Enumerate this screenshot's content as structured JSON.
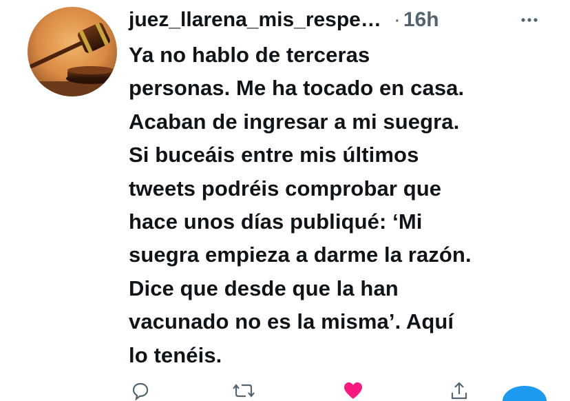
{
  "tweet": {
    "username": "juez_llarena_mis_respe…",
    "separator": "·",
    "time": "16h",
    "body_lines": [
      "Ya no hablo de terceras",
      "personas. Me ha tocado en casa.",
      "Acaban de ingresar a mi suegra.",
      "Si buceáis entre mis últimos",
      "tweets podréis comprobar que",
      "hace unos días publiqué: ‘Mi",
      "suegra empieza a darme la razón.",
      "Dice que desde que la han",
      "vacunado no es la misma’. Aquí",
      "lo tenéis."
    ]
  },
  "actions": {
    "reply_icon": "reply-icon",
    "retweet_icon": "retweet-icon",
    "like_icon": "heart-icon",
    "share_icon": "share-icon"
  },
  "colors": {
    "text": "#0f1419",
    "muted": "#536471",
    "like": "#f91880",
    "accent": "#1d9bf0"
  }
}
